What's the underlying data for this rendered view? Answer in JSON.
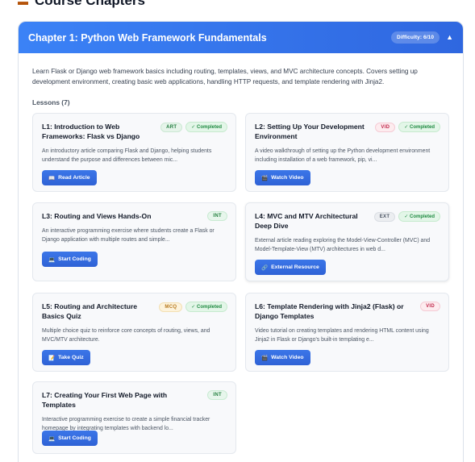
{
  "page": {
    "heading": "Course Chapters",
    "heading_icon": "book-icon"
  },
  "chapter": {
    "title": "Chapter 1: Python Web Framework Fundamentals",
    "difficulty": "Difficulty: 6/10",
    "toggle_icon": "▲",
    "description": "Learn Flask or Django web framework basics including routing, templates, views, and MVC architecture concepts. Covers setting up development environment, creating basic web applications, handling HTTP requests, and template rendering with Jinja2.",
    "lessons_heading": "Lessons (7)",
    "colors": {
      "header_start": "#3b82f6",
      "header_end": "#2f67e0",
      "button": "#2f62d6"
    }
  },
  "lessons": [
    {
      "title": "L1: Introduction to Web Frameworks: Flask vs Django",
      "type": "ART",
      "status": "✓ Completed",
      "description": "An introductory article comparing Flask and Django, helping students understand the purpose and differences between mic...",
      "action_icon": "📖",
      "action": "Read Article"
    },
    {
      "title": "L2: Setting Up Your Development Environment",
      "type": "VID",
      "status": "✓ Completed",
      "description": "A video walkthrough of setting up the Python development environment including installation of a web framework, pip, vi...",
      "action_icon": "🎬",
      "action": "Watch Video"
    },
    {
      "title": "L3: Routing and Views Hands-On",
      "type": "INT",
      "status": "",
      "description": "An interactive programming exercise where students create a Flask or Django application with multiple routes and simple...",
      "action_icon": "💻",
      "action": "Start Coding"
    },
    {
      "title": "L4: MVC and MTV Architectural Deep Dive",
      "type": "EXT",
      "status": "✓ Completed",
      "description": "External article reading exploring the Model-View-Controller (MVC) and Model-Template-View (MTV) architectures in web d...",
      "action_icon": "🔗",
      "action": "External Resource"
    },
    {
      "title": "L5: Routing and Architecture Basics Quiz",
      "type": "MCQ",
      "status": "✓ Completed",
      "description": "Multiple choice quiz to reinforce core concepts of routing, views, and MVC/MTV architecture.",
      "action_icon": "📝",
      "action": "Take Quiz"
    },
    {
      "title": "L6: Template Rendering with Jinja2 (Flask) or Django Templates",
      "type": "VID",
      "status": "",
      "description": "Video tutorial on creating templates and rendering HTML content using Jinja2 in Flask or Django's built-in templating e...",
      "action_icon": "🎬",
      "action": "Watch Video"
    },
    {
      "title": "L7: Creating Your First Web Page with Templates",
      "type": "INT",
      "status": "",
      "description": "Interactive programming exercise to create a simple financial tracker homepage by integrating templates with backend lo...",
      "action_icon": "💻",
      "action": "Start Coding"
    }
  ]
}
